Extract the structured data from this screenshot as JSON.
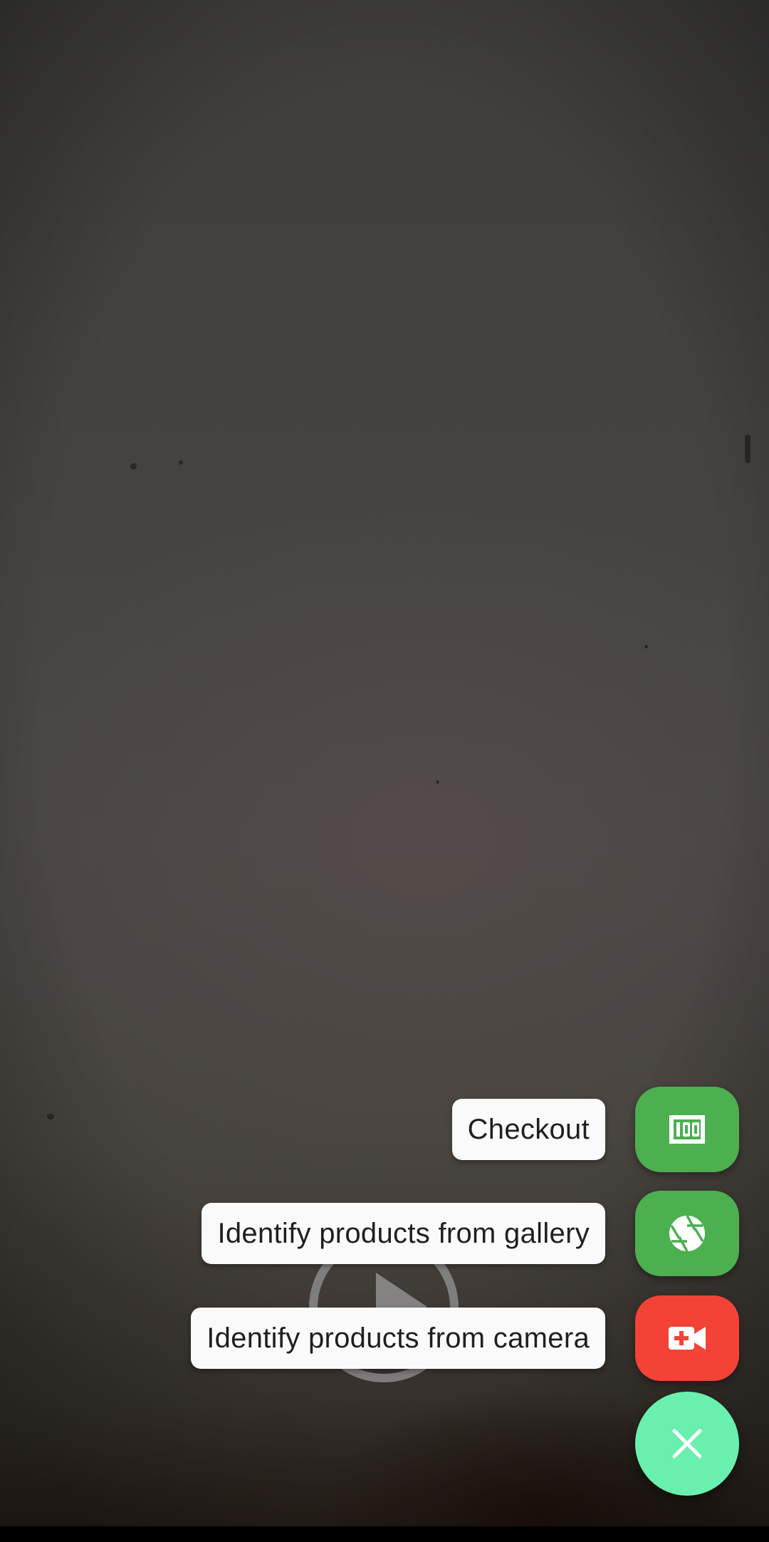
{
  "speed_dial": {
    "actions": [
      {
        "label": "Checkout",
        "icon": "receipt-counter-icon",
        "color": "#4caf50"
      },
      {
        "label": "Identify products from gallery",
        "icon": "camera-aperture-icon",
        "color": "#4caf50"
      },
      {
        "label": "Identify products from camera",
        "icon": "video-add-icon",
        "color": "#f44336"
      }
    ],
    "main_fab": {
      "icon": "close-icon",
      "color": "#69f0ae"
    }
  },
  "overlay": {
    "icon": "play-icon"
  }
}
